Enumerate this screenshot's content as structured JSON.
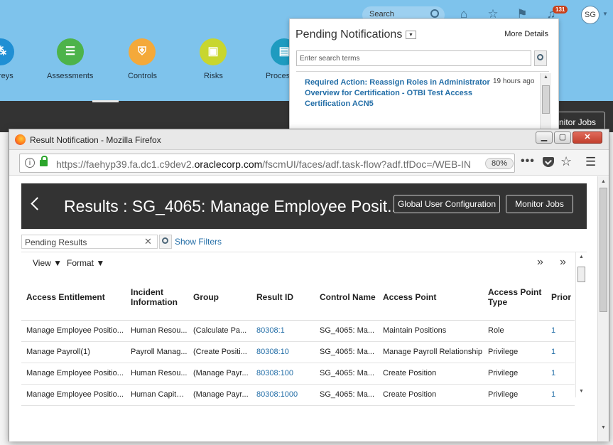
{
  "background_app": {
    "search_placeholder": "Search",
    "notification_count": "131",
    "user_initials": "SG",
    "tiles": [
      {
        "label": "reys",
        "icon": "surveys-icon",
        "color": "#1f8fd4"
      },
      {
        "label": "Assessments",
        "icon": "assessments-icon",
        "color": "#4db34a"
      },
      {
        "label": "Controls",
        "icon": "controls-icon",
        "color": "#f4a93a"
      },
      {
        "label": "Risks",
        "icon": "risks-icon",
        "color": "#c8d62e"
      },
      {
        "label": "Proces",
        "icon": "processes-icon",
        "color": "#1e9bc0"
      }
    ],
    "monitor_jobs_partial": "nitor Jobs"
  },
  "notifications": {
    "title": "Pending Notifications",
    "more_details": "More Details",
    "search_placeholder": "Enter search terms",
    "items": [
      {
        "text": "Required Action: Reassign Roles in Administrator Overview for Certification - OTBI Test Access Certification ACN5",
        "time": "19 hours ago"
      }
    ]
  },
  "browser": {
    "window_title": "Result Notification - Mozilla Firefox",
    "url_prefix": "https://faehyp39.fa.dc1.c9dev2.",
    "url_domain": "oraclecorp.com",
    "url_suffix": "/fscmUI/faces/adf.task-flow?adf.tfDoc=/WEB-INF",
    "zoom": "80%",
    "controls": {
      "minimize": "▁",
      "maximize": "▢",
      "close": "✕"
    }
  },
  "page": {
    "title": "Results : SG_4065: Manage Employee Posit...",
    "global_user_config_button": "Global User Configuration",
    "monitor_jobs_button": "Monitor Jobs",
    "filter_value": "Pending Results",
    "show_filters": "Show Filters",
    "toolbar": {
      "view": "View",
      "format": "Format"
    }
  },
  "table": {
    "columns": [
      "Access Entitlement",
      "Incident Information",
      "Group",
      "Result ID",
      "Control Name",
      "Access Point",
      "Access Point Type",
      "Prior"
    ],
    "rows": [
      [
        "Manage Employee Positio...",
        "Human Resou...",
        "(Calculate Pa...",
        "80308:1",
        "SG_4065: Ma...",
        "Maintain Positions",
        "Role",
        "1"
      ],
      [
        "Manage Payroll(1)",
        "Payroll Manag...",
        "(Create Positi...",
        "80308:10",
        "SG_4065: Ma...",
        "Manage Payroll Relationship",
        "Privilege",
        "1"
      ],
      [
        "Manage Employee Positio...",
        "Human Resou...",
        "(Manage Payr...",
        "80308:100",
        "SG_4065: Ma...",
        "Create Position",
        "Privilege",
        "1"
      ],
      [
        "Manage Employee Positio...",
        "Human Capital...",
        "(Manage Payr...",
        "80308:1000",
        "SG_4065: Ma...",
        "Create Position",
        "Privilege",
        "1"
      ]
    ]
  }
}
